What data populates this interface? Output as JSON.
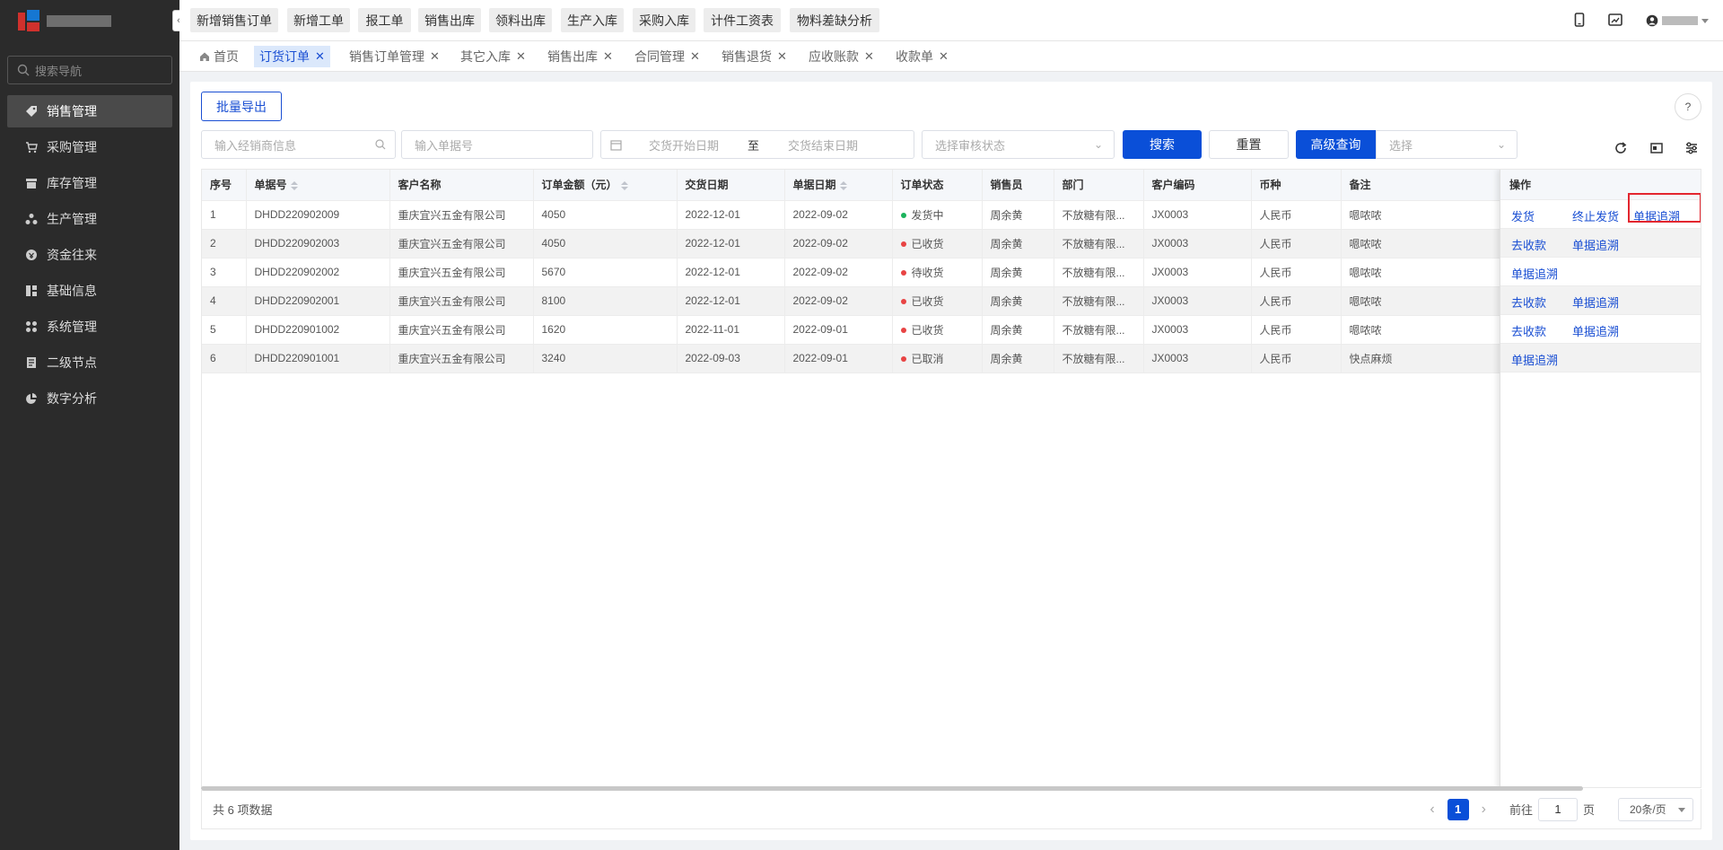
{
  "sidebar": {
    "search_placeholder": "搜索导航",
    "items": [
      {
        "label": "销售管理",
        "icon": "tag-icon"
      },
      {
        "label": "采购管理",
        "icon": "cart-icon"
      },
      {
        "label": "库存管理",
        "icon": "warehouse-icon"
      },
      {
        "label": "生产管理",
        "icon": "production-icon"
      },
      {
        "label": "资金往来",
        "icon": "fund-icon"
      },
      {
        "label": "基础信息",
        "icon": "info-icon"
      },
      {
        "label": "系统管理",
        "icon": "apps-icon"
      },
      {
        "label": "二级节点",
        "icon": "doc-icon"
      },
      {
        "label": "数字分析",
        "icon": "pie-icon"
      }
    ]
  },
  "topbar": {
    "quick_links": [
      "新增销售订单",
      "新增工单",
      "报工单",
      "销售出库",
      "领料出库",
      "生产入库",
      "采购入库",
      "计件工资表",
      "物料差缺分析"
    ]
  },
  "tabs": [
    {
      "label": "首页"
    },
    {
      "label": "订货订单"
    },
    {
      "label": "销售订单管理"
    },
    {
      "label": "其它入库"
    },
    {
      "label": "销售出库"
    },
    {
      "label": "合同管理"
    },
    {
      "label": "销售退货"
    },
    {
      "label": "应收账款"
    },
    {
      "label": "收款单"
    }
  ],
  "toolbar": {
    "export_label": "批量导出",
    "dealer_placeholder": "输入经销商信息",
    "order_no_placeholder": "输入单据号",
    "start_date_placeholder": "交货开始日期",
    "date_separator": "至",
    "end_date_placeholder": "交货结束日期",
    "audit_placeholder": "选择审核状态",
    "search_label": "搜索",
    "reset_label": "重置",
    "advanced_label": "高级查询",
    "select_placeholder": "选择"
  },
  "table": {
    "headers": [
      "序号",
      "单据号",
      "客户名称",
      "订单金额（元）",
      "交货日期",
      "单据日期",
      "订单状态",
      "销售员",
      "部门",
      "客户编码",
      "币种",
      "备注"
    ],
    "ops_header": "操作",
    "rows": [
      {
        "cells": [
          "1",
          "DHDD220902009",
          "重庆宜兴五金有限公司",
          "4050",
          "2022-12-01",
          "2022-09-02",
          "发货中",
          "周余黄",
          "不放糖有限...",
          "JX0003",
          "人民币",
          "嗯哝哝"
        ],
        "status_color": "#1bb35c",
        "ops": [
          "发货",
          "终止发货",
          "单据追溯"
        ]
      },
      {
        "cells": [
          "2",
          "DHDD220902003",
          "重庆宜兴五金有限公司",
          "4050",
          "2022-12-01",
          "2022-09-02",
          "已收货",
          "周余黄",
          "不放糖有限...",
          "JX0003",
          "人民币",
          "嗯哝哝"
        ],
        "status_color": "#e84343",
        "ops": [
          "去收款",
          "单据追溯"
        ]
      },
      {
        "cells": [
          "3",
          "DHDD220902002",
          "重庆宜兴五金有限公司",
          "5670",
          "2022-12-01",
          "2022-09-02",
          "待收货",
          "周余黄",
          "不放糖有限...",
          "JX0003",
          "人民币",
          "嗯哝哝"
        ],
        "status_color": "#e84343",
        "ops": [
          "单据追溯"
        ]
      },
      {
        "cells": [
          "4",
          "DHDD220902001",
          "重庆宜兴五金有限公司",
          "8100",
          "2022-12-01",
          "2022-09-02",
          "已收货",
          "周余黄",
          "不放糖有限...",
          "JX0003",
          "人民币",
          "嗯哝哝"
        ],
        "status_color": "#e84343",
        "ops": [
          "去收款",
          "单据追溯"
        ]
      },
      {
        "cells": [
          "5",
          "DHDD220901002",
          "重庆宜兴五金有限公司",
          "1620",
          "2022-11-01",
          "2022-09-01",
          "已收货",
          "周余黄",
          "不放糖有限...",
          "JX0003",
          "人民币",
          "嗯哝哝"
        ],
        "status_color": "#e84343",
        "ops": [
          "去收款",
          "单据追溯"
        ]
      },
      {
        "cells": [
          "6",
          "DHDD220901001",
          "重庆宜兴五金有限公司",
          "3240",
          "2022-09-03",
          "2022-09-01",
          "已取消",
          "周余黄",
          "不放糖有限...",
          "JX0003",
          "人民币",
          "快点麻烦"
        ],
        "status_color": "#e84343",
        "ops": [
          "单据追溯"
        ]
      }
    ]
  },
  "footer": {
    "total": "共 6 项数据",
    "current_page": "1",
    "goto_prefix": "前往",
    "goto_value": "1",
    "goto_suffix": "页",
    "page_size": "20条/页"
  },
  "colors": {
    "primary": "#0a4fd8",
    "sidebar_bg": "#2b2b2b",
    "highlight": "#e3262f"
  }
}
